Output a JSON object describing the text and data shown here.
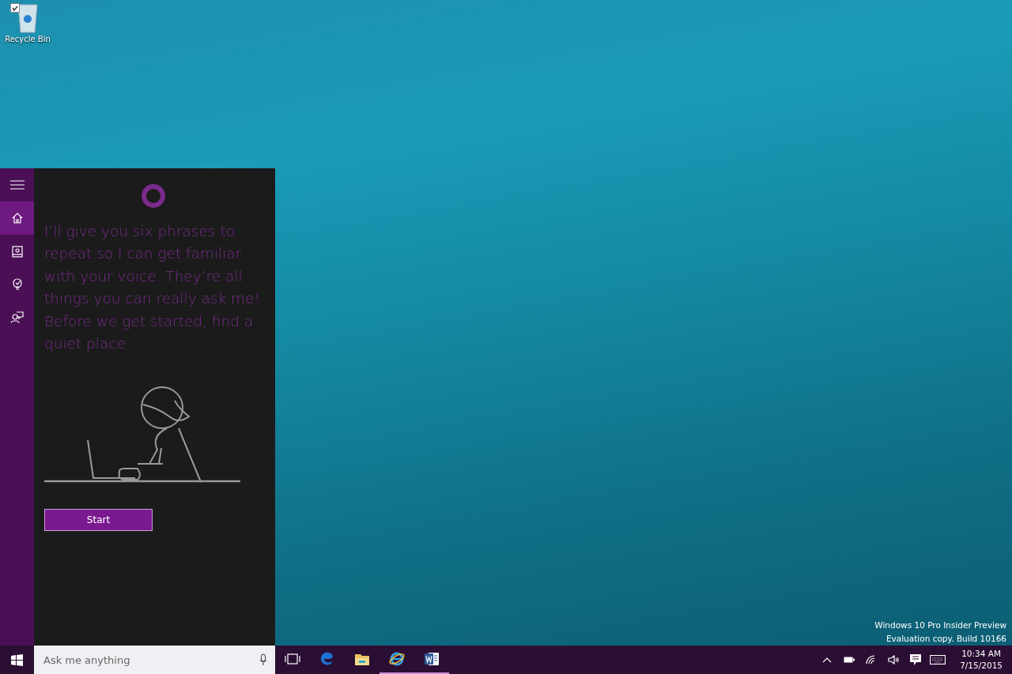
{
  "desktop": {
    "icons": [
      {
        "label": "Recycle Bin",
        "checked": true
      }
    ],
    "watermark": [
      "Windows 10 Pro Insider Preview",
      "Evaluation copy. Build 10166"
    ]
  },
  "cortana": {
    "nav": [
      {
        "kind": "menu",
        "selected": false
      },
      {
        "kind": "home",
        "selected": true
      },
      {
        "kind": "notebook",
        "selected": false
      },
      {
        "kind": "bulb",
        "selected": false
      },
      {
        "kind": "feedback",
        "selected": false
      }
    ],
    "message": "I’ll give you six phrases to repeat so I can get familiar with your voice. They’re all things you can really ask me! Before we get started, find a quiet place.",
    "button": "Start"
  },
  "taskbar": {
    "search": {
      "placeholder": "Ask me anything"
    },
    "apps": [
      {
        "kind": "taskview",
        "running": false
      },
      {
        "kind": "edge",
        "running": false
      },
      {
        "kind": "explorer",
        "running": false
      },
      {
        "kind": "ie",
        "running": true
      },
      {
        "kind": "word",
        "running": true
      }
    ],
    "tray": [
      {
        "kind": "chevron"
      },
      {
        "kind": "battery"
      },
      {
        "kind": "wifi"
      },
      {
        "kind": "volume"
      },
      {
        "kind": "action"
      },
      {
        "kind": "keyboard"
      }
    ],
    "time": "10:34 AM",
    "date": "7/15/2015"
  }
}
